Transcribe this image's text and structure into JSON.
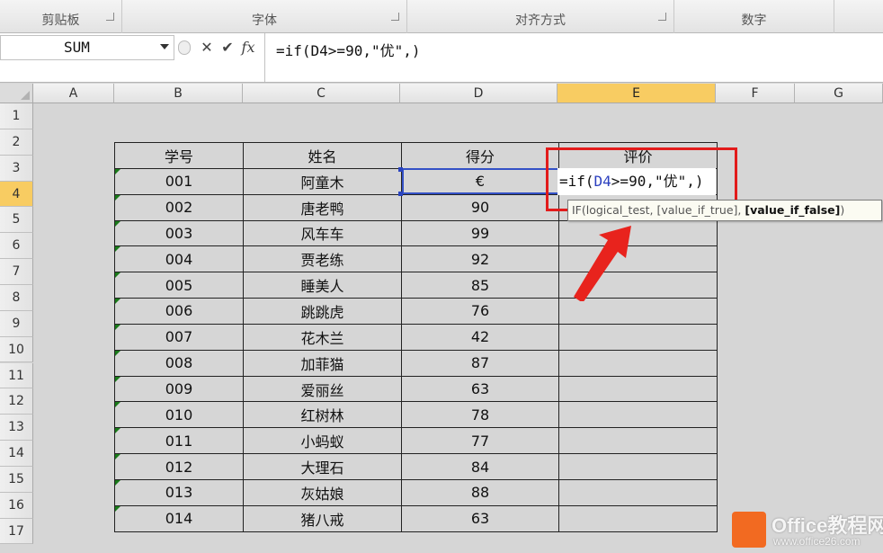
{
  "ribbon": {
    "groups": [
      {
        "label": "剪贴板"
      },
      {
        "label": "字体"
      },
      {
        "label": "对齐方式"
      },
      {
        "label": "数字"
      }
    ]
  },
  "formula_bar": {
    "name_box": "SUM",
    "cancel_icon": "✕",
    "enter_icon": "✔",
    "fx_label": "fx",
    "formula": "=if(D4>=90,\"优\",)"
  },
  "sheet": {
    "columns": [
      "A",
      "B",
      "C",
      "D",
      "E",
      "F",
      "G"
    ],
    "rows": [
      "1",
      "2",
      "3",
      "4",
      "5",
      "6",
      "7",
      "8",
      "9",
      "10",
      "11",
      "12",
      "13",
      "14",
      "15",
      "16",
      "17"
    ],
    "active_column": "E",
    "active_row": "4",
    "header": {
      "id": "学号",
      "name": "姓名",
      "score": "得分",
      "rating": "评价"
    },
    "records": [
      {
        "id": "001",
        "name": "阿童木",
        "score": "€"
      },
      {
        "id": "002",
        "name": "唐老鸭",
        "score": "90"
      },
      {
        "id": "003",
        "name": "风车车",
        "score": "99"
      },
      {
        "id": "004",
        "name": "贾老练",
        "score": "92"
      },
      {
        "id": "005",
        "name": "睡美人",
        "score": "85"
      },
      {
        "id": "006",
        "name": "跳跳虎",
        "score": "76"
      },
      {
        "id": "007",
        "name": "花木兰",
        "score": "42"
      },
      {
        "id": "008",
        "name": "加菲猫",
        "score": "87"
      },
      {
        "id": "009",
        "name": "爱丽丝",
        "score": "63"
      },
      {
        "id": "010",
        "name": "红树林",
        "score": "78"
      },
      {
        "id": "011",
        "name": "小蚂蚁",
        "score": "77"
      },
      {
        "id": "012",
        "name": "大理石",
        "score": "84"
      },
      {
        "id": "013",
        "name": "灰姑娘",
        "score": "88"
      },
      {
        "id": "014",
        "name": "猪八戒",
        "score": "63"
      }
    ]
  },
  "editing": {
    "prefix": "=if(",
    "ref": "D4",
    "suffix": ">=90,\"优\",)"
  },
  "tooltip": {
    "text": "IF(logical_test, [value_if_true], ",
    "bold": "[value_if_false]",
    "end": ")"
  },
  "watermark": {
    "brand": "Office教程网",
    "url": "www.office26.com"
  },
  "colors": {
    "highlight_box": "#e21b1b",
    "selection": "#3451c6",
    "active_header": "#f8cc62"
  }
}
